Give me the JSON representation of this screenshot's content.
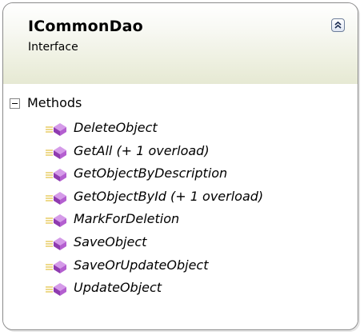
{
  "shape": {
    "title": "ICommonDao",
    "stereotype": "Interface",
    "collapse_icon": "double-chevron-up-icon"
  },
  "section": {
    "label": "Methods",
    "expander_icon": "minus-box-icon"
  },
  "methods": [
    {
      "label": "DeleteObject",
      "icon": "method-icon"
    },
    {
      "label": "GetAll (+ 1 overload)",
      "icon": "method-icon"
    },
    {
      "label": "GetObjectByDescription",
      "icon": "method-icon"
    },
    {
      "label": "GetObjectById (+ 1 overload)",
      "icon": "method-icon"
    },
    {
      "label": "MarkForDeletion",
      "icon": "method-icon"
    },
    {
      "label": "SaveObject",
      "icon": "method-icon"
    },
    {
      "label": "SaveOrUpdateObject",
      "icon": "method-icon"
    },
    {
      "label": "UpdateObject",
      "icon": "method-icon"
    }
  ],
  "colors": {
    "border": "#8a8a8a",
    "header_gradient_end": "#e6e9d3",
    "method_icon": "#a349c2"
  }
}
